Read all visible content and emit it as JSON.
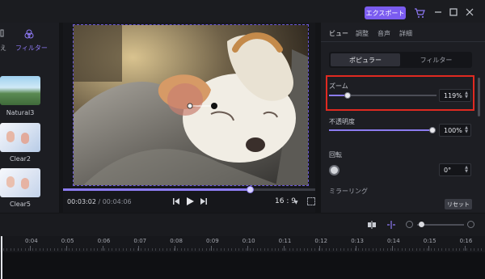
{
  "topbar": {
    "export_label": "エクスポート"
  },
  "left_panel": {
    "tabs": [
      {
        "label": "え"
      },
      {
        "label": "フィルター"
      }
    ],
    "items": [
      {
        "label": "Natural3"
      },
      {
        "label": "Clear2"
      },
      {
        "label": "Clear5"
      }
    ]
  },
  "player": {
    "current_time": "00:03:02",
    "separator": " / ",
    "total_time": "00:04:06",
    "aspect_ratio": "16 : 9",
    "progress_fraction": 0.74
  },
  "right_panel": {
    "tabs": [
      {
        "label": "ビュー"
      },
      {
        "label": "調整"
      },
      {
        "label": "音声"
      },
      {
        "label": "詳細"
      }
    ],
    "segments": {
      "popular": "ポピュラー",
      "filter": "フィルター"
    },
    "zoom": {
      "label": "ズーム",
      "value": "119%",
      "fraction": 0.17
    },
    "opacity": {
      "label": "不透明度",
      "value": "100%",
      "fraction": 1.0
    },
    "rotation": {
      "label": "回転",
      "value": "0°"
    },
    "mirror": {
      "label": "ミラーリング"
    },
    "reset_label": "リセット"
  },
  "timeline": {
    "ticks": [
      "0:04",
      "0:05",
      "0:06",
      "0:07",
      "0:08",
      "0:09",
      "0:10",
      "0:11",
      "0:12",
      "0:13",
      "0:14",
      "0:15",
      "0:16"
    ]
  },
  "colors": {
    "accent": "#7b5cf0",
    "highlight": "#e02a21"
  }
}
